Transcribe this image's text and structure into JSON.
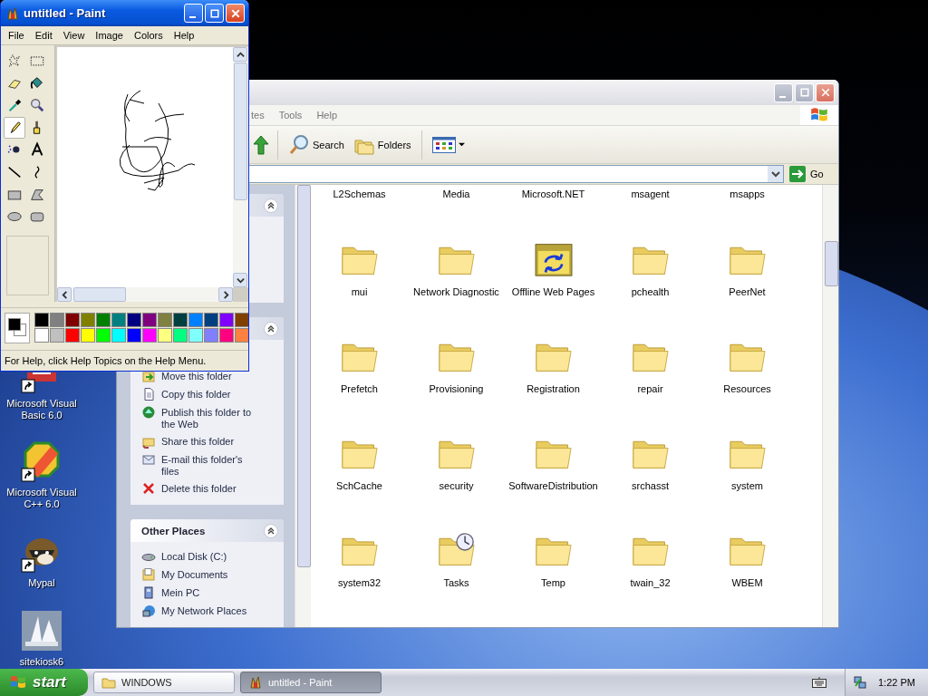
{
  "desktop": {
    "icons": [
      {
        "label": "Microsoft Visual Basic 6.0",
        "kind": "vb",
        "shortcut": true
      },
      {
        "label": "Microsoft Visual C++ 6.0",
        "kind": "vc",
        "shortcut": true
      },
      {
        "label": "Mypal",
        "kind": "raccoon",
        "shortcut": true
      },
      {
        "label": "sitekiosk6",
        "kind": "sails",
        "shortcut": false
      }
    ]
  },
  "explorer": {
    "menu": [
      "tes",
      "Tools",
      "Help"
    ],
    "toolbar": [
      {
        "label": "Search",
        "kind": "search"
      },
      {
        "label": "Folders",
        "kind": "folders"
      }
    ],
    "go": "Go",
    "panels": [
      {
        "items": [
          {
            "label": "Move this folder",
            "kind": "move"
          },
          {
            "label": "Copy this folder",
            "kind": "copy"
          },
          {
            "label": "Publish this folder to the Web",
            "kind": "publish"
          },
          {
            "label": "Share this folder",
            "kind": "share"
          },
          {
            "label": "E-mail this folder's files",
            "kind": "email"
          },
          {
            "label": "Delete this folder",
            "kind": "delete"
          }
        ]
      },
      {
        "title": "Other Places",
        "items": [
          {
            "label": "Local Disk (C:)",
            "kind": "disk"
          },
          {
            "label": "My Documents",
            "kind": "documents"
          },
          {
            "label": "Mein PC",
            "kind": "computer"
          },
          {
            "label": "My Network Places",
            "kind": "network"
          }
        ]
      }
    ],
    "folders": [
      {
        "label": "L2Schemas",
        "kind": "scrolled"
      },
      {
        "label": "Media",
        "kind": "scrolled"
      },
      {
        "label": "Microsoft.NET",
        "kind": "scrolled"
      },
      {
        "label": "msagent",
        "kind": "scrolled"
      },
      {
        "label": "msapps",
        "kind": "scrolled"
      },
      {
        "label": "mui",
        "kind": "folder"
      },
      {
        "label": "Network Diagnostic",
        "kind": "folder"
      },
      {
        "label": "Offline Web Pages",
        "kind": "web"
      },
      {
        "label": "pchealth",
        "kind": "folder"
      },
      {
        "label": "PeerNet",
        "kind": "folder"
      },
      {
        "label": "Prefetch",
        "kind": "folder"
      },
      {
        "label": "Provisioning",
        "kind": "folder"
      },
      {
        "label": "Registration",
        "kind": "folder"
      },
      {
        "label": "repair",
        "kind": "folder"
      },
      {
        "label": "Resources",
        "kind": "folder"
      },
      {
        "label": "SchCache",
        "kind": "folder"
      },
      {
        "label": "security",
        "kind": "folder"
      },
      {
        "label": "SoftwareDistribution",
        "kind": "folder"
      },
      {
        "label": "srchasst",
        "kind": "folder"
      },
      {
        "label": "system",
        "kind": "folder"
      },
      {
        "label": "system32",
        "kind": "folder"
      },
      {
        "label": "Tasks",
        "kind": "tasks"
      },
      {
        "label": "Temp",
        "kind": "folder"
      },
      {
        "label": "twain_32",
        "kind": "folder"
      },
      {
        "label": "WBEM",
        "kind": "folder"
      }
    ]
  },
  "paint": {
    "title": "untitled - Paint",
    "menu": [
      "File",
      "Edit",
      "View",
      "Image",
      "Colors",
      "Help"
    ],
    "tools": [
      {
        "kind": "free-select",
        "selected": false
      },
      {
        "kind": "select",
        "selected": false
      },
      {
        "kind": "eraser",
        "selected": false
      },
      {
        "kind": "fill",
        "selected": false
      },
      {
        "kind": "picker",
        "selected": false
      },
      {
        "kind": "magnifier",
        "selected": false
      },
      {
        "kind": "pencil",
        "selected": true
      },
      {
        "kind": "brush",
        "selected": false
      },
      {
        "kind": "airbrush",
        "selected": false
      },
      {
        "kind": "text",
        "selected": false
      },
      {
        "kind": "line",
        "selected": false
      },
      {
        "kind": "curve",
        "selected": false
      },
      {
        "kind": "rectangle",
        "selected": false
      },
      {
        "kind": "polygon",
        "selected": false
      },
      {
        "kind": "ellipse",
        "selected": false
      },
      {
        "kind": "rounded-rectangle",
        "selected": false
      }
    ],
    "palette": [
      {
        "color": "#000000"
      },
      {
        "color": "#808080"
      },
      {
        "color": "#800000"
      },
      {
        "color": "#808000"
      },
      {
        "color": "#008000"
      },
      {
        "color": "#008080"
      },
      {
        "color": "#000080"
      },
      {
        "color": "#800080"
      },
      {
        "color": "#808040"
      },
      {
        "color": "#004040"
      },
      {
        "color": "#0080ff"
      },
      {
        "color": "#004080"
      },
      {
        "color": "#8000ff"
      },
      {
        "color": "#804000"
      },
      {
        "color": "#ffffff"
      },
      {
        "color": "#c0c0c0"
      },
      {
        "color": "#ff0000"
      },
      {
        "color": "#ffff00"
      },
      {
        "color": "#00ff00"
      },
      {
        "color": "#00ffff"
      },
      {
        "color": "#0000ff"
      },
      {
        "color": "#ff00ff"
      },
      {
        "color": "#ffff80"
      },
      {
        "color": "#00ff80"
      },
      {
        "color": "#80ffff"
      },
      {
        "color": "#8080ff"
      },
      {
        "color": "#ff0080"
      },
      {
        "color": "#ff8040"
      }
    ],
    "status": "For Help, click Help Topics on the Help Menu."
  },
  "taskbar": {
    "start": "start",
    "tasks": [
      {
        "label": "WINDOWS",
        "kind": "folder",
        "selected": false
      },
      {
        "label": "untitled - Paint",
        "kind": "paint",
        "selected": true
      }
    ],
    "clock": "1:22 PM"
  }
}
